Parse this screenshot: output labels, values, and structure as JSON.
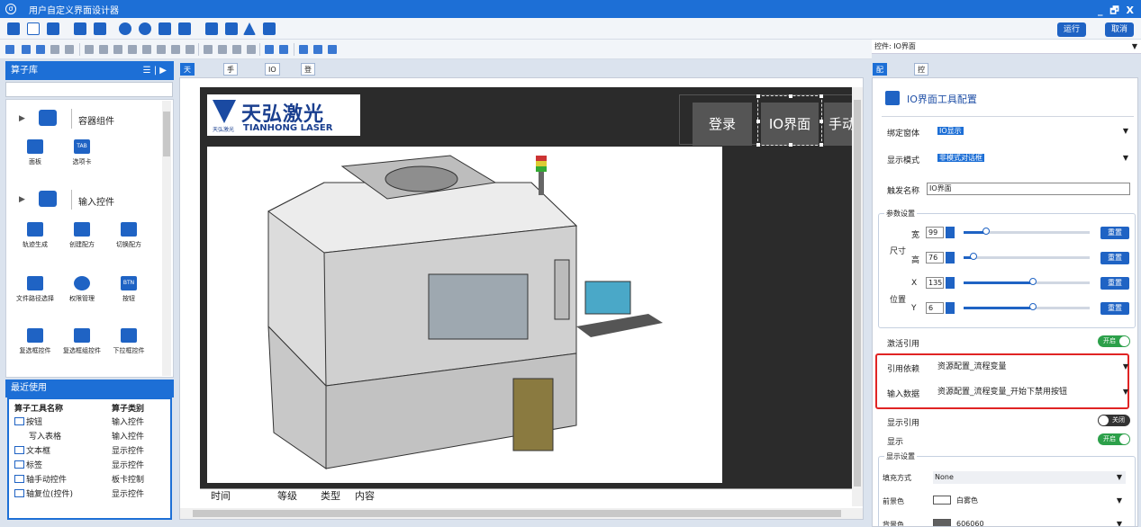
{
  "window": {
    "title": "用户自定义界面设计器",
    "controls": "_ 🗗 X"
  },
  "toolbar": {
    "run": "运行",
    "cancel": "取消"
  },
  "control_selector": {
    "value": "控件: IO界面"
  },
  "left_panel": {
    "title": "算子库",
    "menu_glyphs": "☰ | ▶",
    "groups": [
      {
        "label": "容器组件",
        "items": [
          {
            "label": "面板",
            "icon": "panel-icon"
          },
          {
            "label": "选项卡",
            "icon": "tab-icon",
            "badge": "TAB"
          }
        ]
      },
      {
        "label": "输入控件",
        "items": [
          {
            "label": "轨迹生成",
            "icon": "location-icon"
          },
          {
            "label": "创建配方",
            "icon": "flask-icon"
          },
          {
            "label": "切换配方",
            "icon": "flask-icon"
          },
          {
            "label": "文件路径选择",
            "icon": "folder-icon"
          },
          {
            "label": "权限管理",
            "icon": "layers-icon"
          },
          {
            "label": "按钮",
            "icon": "button-icon",
            "badge": "BTN"
          },
          {
            "label": "复选框控件",
            "icon": "checkbox-icon"
          },
          {
            "label": "复选框组控件",
            "icon": "list-icon"
          },
          {
            "label": "下拉框控件",
            "icon": "dropdown-icon"
          }
        ]
      }
    ]
  },
  "recent": {
    "title": "最近使用",
    "columns": [
      "算子工具名称",
      "算子类别"
    ],
    "rows": [
      {
        "name": "按钮",
        "category": "输入控件"
      },
      {
        "name": "写入表格",
        "category": "输入控件"
      },
      {
        "name": "文本框",
        "category": "显示控件"
      },
      {
        "name": "标签",
        "category": "显示控件"
      },
      {
        "name": "轴手动控件",
        "category": "板卡控制"
      },
      {
        "name": "轴复位(控件)",
        "category": "显示控件"
      }
    ]
  },
  "canvas": {
    "tabs": [
      "天弘激光",
      "手动界面",
      "IO显示",
      "登录"
    ],
    "logo": {
      "cn": "天弘激光",
      "small": "天弘激光",
      "en": "TIANHONG LASER"
    },
    "nav_buttons": [
      "登录",
      "IO界面",
      "手动"
    ],
    "log_columns": [
      "时间",
      "等级",
      "类型",
      "内容"
    ]
  },
  "right_panel": {
    "tabs": [
      "配置界面",
      "控件大纲"
    ],
    "header": "IO界面工具配置",
    "bind_window": {
      "label": "绑定窗体",
      "value": "IO显示"
    },
    "display_mode": {
      "label": "显示模式",
      "value": "非模式对话框"
    },
    "trigger_name": {
      "label": "触发名称",
      "value": "IO界面"
    },
    "params": {
      "legend": "参数设置",
      "size_label": "尺寸",
      "pos_label": "位置",
      "reset": "重置",
      "width": {
        "label": "宽",
        "value": "99",
        "level": 0.18
      },
      "height": {
        "label": "高",
        "value": "76",
        "level": 0.08
      },
      "x": {
        "label": "X",
        "value": "135",
        "level": 0.55
      },
      "y": {
        "label": "Y",
        "value": "6",
        "level": 0.55
      }
    },
    "activate_ref": {
      "label": "激活引用",
      "toggle": "开启"
    },
    "ref_dep": {
      "label": "引用依赖",
      "value": "资源配置_流程变量"
    },
    "input_data": {
      "label": "输入数据",
      "value": "资源配置_流程变量_开始下禁用按钮"
    },
    "show_ref": {
      "label": "显示引用",
      "toggle": "关闭"
    },
    "show": {
      "label": "显示",
      "toggle": "开启"
    },
    "display": {
      "legend": "显示设置",
      "fill_mode": {
        "label": "填充方式",
        "value": "None"
      },
      "foreground": {
        "label": "前景色",
        "value": "白雾色",
        "color": "#ffffff"
      },
      "background": {
        "label": "背景色",
        "value": "606060",
        "color": "#606060"
      }
    }
  },
  "colors": {
    "accent": "#1d6fd6",
    "highlight": "#e02424",
    "toggle_on": "#2ca04a"
  }
}
